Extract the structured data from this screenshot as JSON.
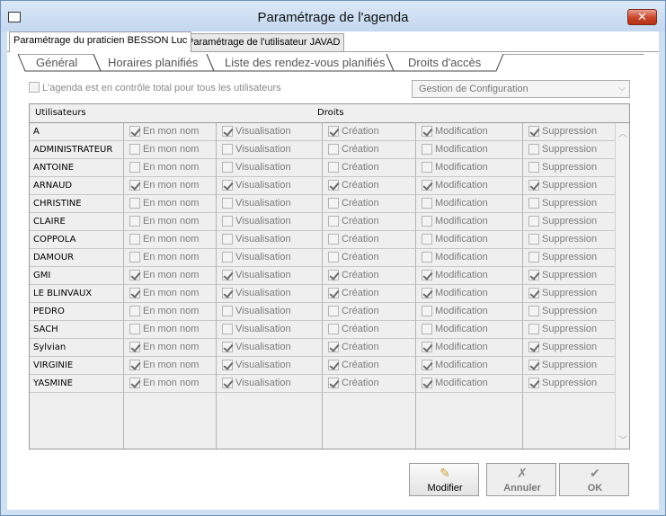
{
  "window": {
    "title": "Paramétrage de l'agenda",
    "close_glyph": "✕"
  },
  "outer_tabs": [
    {
      "label": "Paramétrage du praticien BESSON Luc",
      "active": true
    },
    {
      "label": "Paramétrage de l'utilisateur JAVAD",
      "active": false
    }
  ],
  "inner_tabs": [
    {
      "label": "Général"
    },
    {
      "label": "Horaires planifiés"
    },
    {
      "label": "Liste des rendez-vous planifiés"
    },
    {
      "label": "Droits d'accès"
    }
  ],
  "total_control": {
    "label": "L'agenda est en contrôle total pour tous les utilisateurs",
    "checked": false
  },
  "config_select": {
    "value": "Gestion de Configuration",
    "arrow_glyph": "⌵"
  },
  "grid": {
    "header_users": "Utilisateurs",
    "header_rights": "Droits",
    "columns": [
      "En mon nom",
      "Visualisation",
      "Création",
      "Modification",
      "Suppression"
    ],
    "rows": [
      {
        "name": "A",
        "checks": [
          true,
          true,
          true,
          true,
          true
        ]
      },
      {
        "name": "ADMINISTRATEUR",
        "checks": [
          false,
          false,
          false,
          false,
          false
        ]
      },
      {
        "name": "ANTOINE",
        "checks": [
          false,
          false,
          false,
          false,
          false
        ]
      },
      {
        "name": "ARNAUD",
        "checks": [
          true,
          true,
          true,
          true,
          true
        ]
      },
      {
        "name": "CHRISTINE",
        "checks": [
          false,
          false,
          false,
          false,
          false
        ]
      },
      {
        "name": "CLAIRE",
        "checks": [
          false,
          false,
          false,
          false,
          false
        ]
      },
      {
        "name": "COPPOLA",
        "checks": [
          false,
          false,
          false,
          false,
          false
        ]
      },
      {
        "name": "DAMOUR",
        "checks": [
          false,
          false,
          false,
          false,
          false
        ]
      },
      {
        "name": "GMI",
        "checks": [
          true,
          true,
          true,
          true,
          true
        ]
      },
      {
        "name": "LE BLINVAUX",
        "checks": [
          true,
          true,
          true,
          true,
          true
        ]
      },
      {
        "name": "PEDRO",
        "checks": [
          false,
          false,
          false,
          false,
          false
        ]
      },
      {
        "name": "SACH",
        "checks": [
          false,
          false,
          false,
          false,
          false
        ]
      },
      {
        "name": "Sylvian",
        "checks": [
          true,
          true,
          true,
          true,
          true
        ]
      },
      {
        "name": "VIRGINIE",
        "checks": [
          true,
          true,
          true,
          true,
          true
        ]
      },
      {
        "name": "YASMINE",
        "checks": [
          true,
          true,
          true,
          true,
          true
        ]
      }
    ]
  },
  "scrollbar": {
    "up_glyph": "︿",
    "down_glyph": "﹀"
  },
  "buttons": {
    "modify": {
      "label": "Modifier",
      "icon": "edit-icon",
      "glyph": "✎"
    },
    "cancel": {
      "label": "Annuler",
      "icon": "cancel-icon",
      "glyph": "✗"
    },
    "ok": {
      "label": "OK",
      "icon": "ok-icon",
      "glyph": "✔"
    }
  }
}
